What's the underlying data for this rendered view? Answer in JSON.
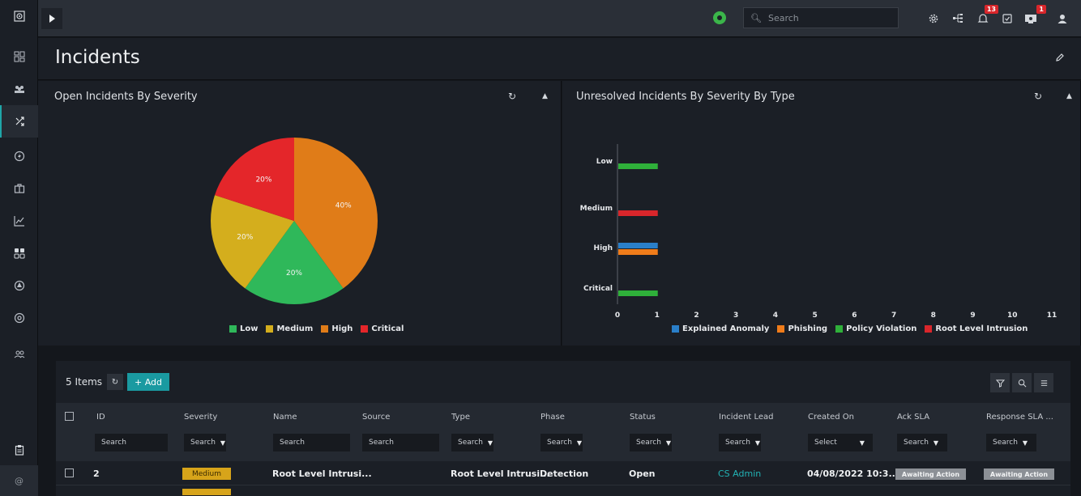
{
  "topbar": {
    "search_placeholder": "Search",
    "notification_count": "13",
    "alert_count": "1"
  },
  "page": {
    "title": "Incidents"
  },
  "left_panel": {
    "title": "Open Incidents By Severity",
    "chart_data": {
      "type": "pie",
      "categories": [
        "Low",
        "Medium",
        "High",
        "Critical"
      ],
      "values": [
        20,
        20,
        40,
        20
      ],
      "labels": [
        "20%",
        "20%",
        "40%",
        "20%"
      ],
      "colors": [
        "#2fb85a",
        "#d4ae1d",
        "#e07c18",
        "#e4262a"
      ],
      "legend_placement": "bottom"
    }
  },
  "right_panel": {
    "title": "Unresolved Incidents By Severity By Type",
    "chart_data": {
      "type": "bar",
      "orientation": "horizontal",
      "categories": [
        "Low",
        "Medium",
        "High",
        "Critical"
      ],
      "series": [
        {
          "name": "Explained Anomaly",
          "color": "#2a7fc9",
          "values": [
            0,
            0,
            1,
            0
          ]
        },
        {
          "name": "Phishing",
          "color": "#f07c1a",
          "values": [
            0,
            0,
            1,
            0
          ]
        },
        {
          "name": "Policy Violation",
          "color": "#2fb03a",
          "values": [
            1,
            0,
            0,
            1
          ]
        },
        {
          "name": "Root Level Intrusion",
          "color": "#d9262b",
          "values": [
            0,
            1,
            0,
            0
          ]
        }
      ],
      "xlim": [
        0,
        11
      ],
      "xticks": [
        0,
        1,
        2,
        3,
        4,
        5,
        6,
        7,
        8,
        9,
        10,
        11
      ],
      "legend_placement": "bottom"
    }
  },
  "table": {
    "items_count": "5 Items",
    "add_label": "+ Add",
    "columns": [
      {
        "label": "ID",
        "filter": "Search",
        "dropdown": false
      },
      {
        "label": "Severity",
        "filter": "Search",
        "dropdown": true
      },
      {
        "label": "Name",
        "filter": "Search",
        "dropdown": false
      },
      {
        "label": "Source",
        "filter": "Search",
        "dropdown": false
      },
      {
        "label": "Type",
        "filter": "Search",
        "dropdown": true
      },
      {
        "label": "Phase",
        "filter": "Search",
        "dropdown": true
      },
      {
        "label": "Status",
        "filter": "Search",
        "dropdown": true
      },
      {
        "label": "Incident Lead",
        "filter": "Search",
        "dropdown": true
      },
      {
        "label": "Created On",
        "filter": "Select",
        "dropdown": true
      },
      {
        "label": "Ack SLA",
        "filter": "Search",
        "dropdown": true
      },
      {
        "label": "Response SLA ...",
        "filter": "Search",
        "dropdown": true
      }
    ],
    "rows": [
      {
        "id": "2",
        "severity": "Medium",
        "name": "Root Level Intrusi...",
        "source": "",
        "type": "Root Level Intrusi...",
        "phase": "Detection",
        "status": "Open",
        "incident_lead": "CS Admin",
        "created_on": "04/08/2022 10:3...",
        "ack_sla": "Awaiting Action",
        "response_sla": "Awaiting Action"
      }
    ]
  },
  "sidebar": {
    "footer_label": "@"
  }
}
